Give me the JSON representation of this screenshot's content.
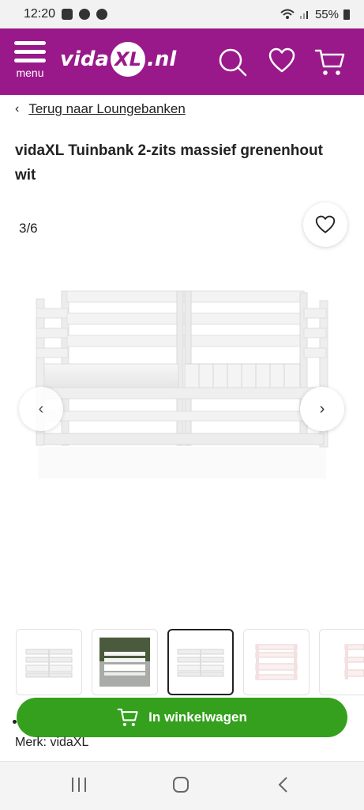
{
  "status_bar": {
    "time": "12:20",
    "battery": "55%"
  },
  "header": {
    "menu_label": "menu",
    "logo_vida": "vida",
    "logo_xl": "XL",
    "logo_nl": ".nl",
    "brand_color": "#99198a"
  },
  "breadcrumb": {
    "chevron": "‹",
    "link": "Terug naar Loungebanken"
  },
  "product": {
    "title": "vidaXL Tuinbank 2-zits massief grenenhout wit",
    "image_counter": "3/6",
    "brand_line": "Merk: vidaXL"
  },
  "gallery": {
    "prev_icon": "‹",
    "next_icon": "›",
    "thumbnails": [
      "bench-white-front",
      "bench-outdoor-photo",
      "bench-white-selected",
      "bench-pink-corner",
      "bench-partial"
    ]
  },
  "cart_button": {
    "label": "In winkelwagen",
    "color": "#35a01d"
  },
  "icons": [
    "menu-icon",
    "search-icon",
    "heart-icon",
    "cart-icon",
    "favorite-heart-icon",
    "chevron-left-icon",
    "chevron-right-icon",
    "recents-icon",
    "home-icon",
    "back-icon"
  ]
}
